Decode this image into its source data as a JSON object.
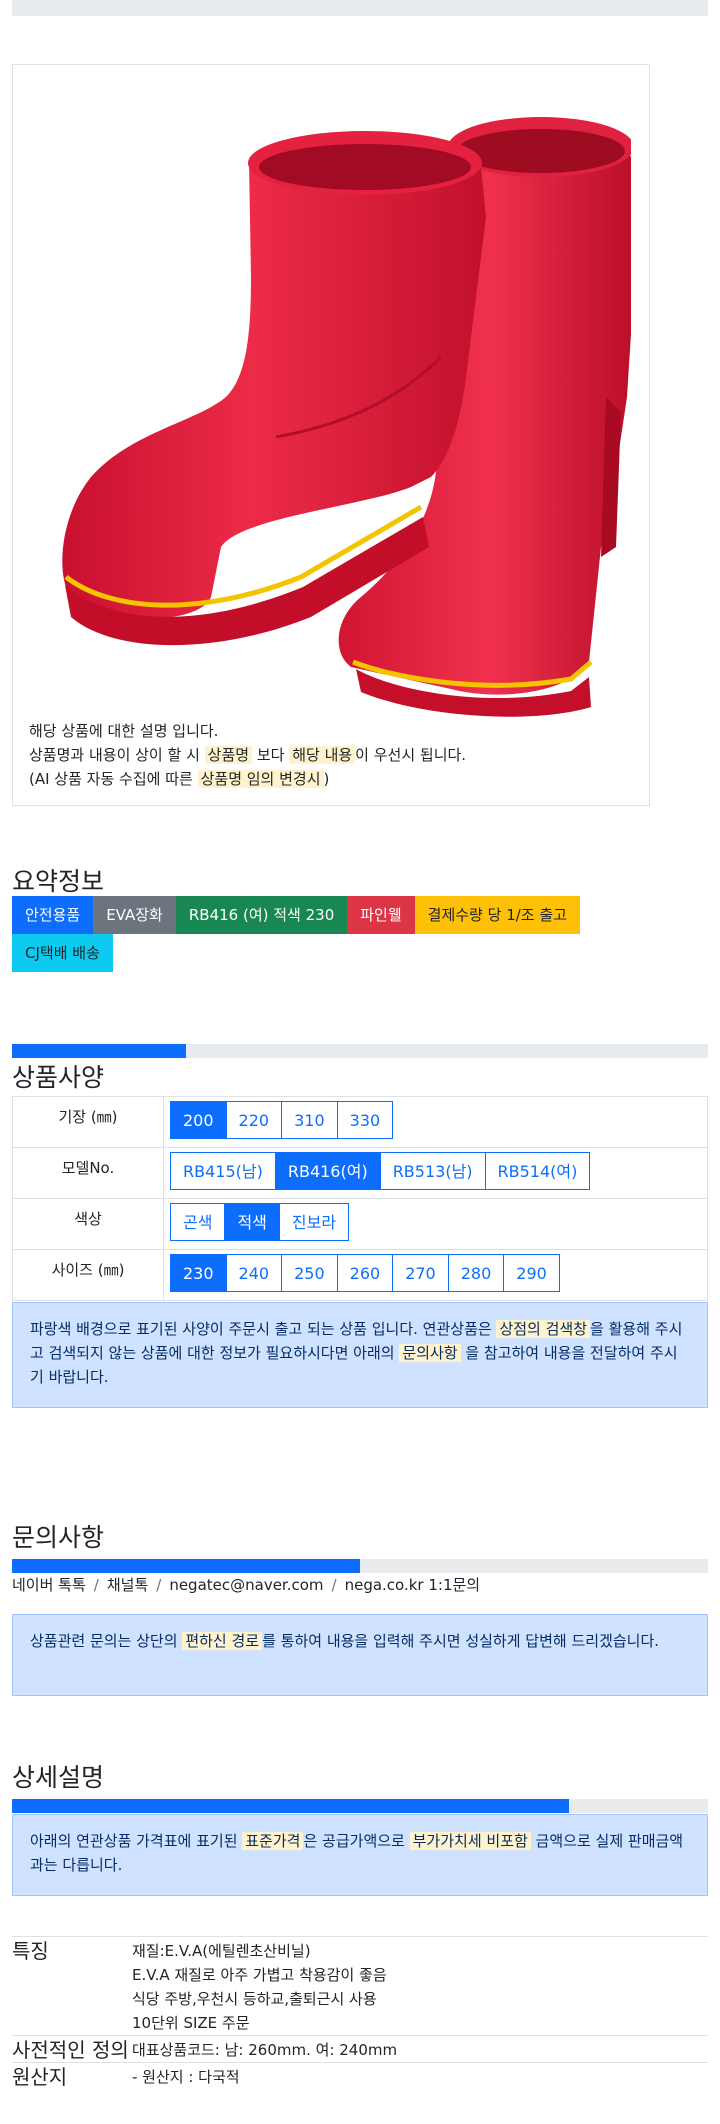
{
  "product": {
    "image_alt": "red rubber boots",
    "desc_line1": "해당 상품에 대한 설명 입니다.",
    "desc_line2_pre": "상품명과 내용이 상이 할 시 ",
    "desc_line2_hl1": "상품명",
    "desc_line2_mid": " 보다 ",
    "desc_line2_hl2": "해당 내용",
    "desc_line2_post": "이 우선시 됩니다.",
    "desc_line3_pre": "(AI 상품 자동 수집에 따른 ",
    "desc_line3_hl": "상품명 임의 변경시",
    "desc_line3_post": ")"
  },
  "summary": {
    "title": "요약정보",
    "badges": [
      "안전용품",
      "EVA장화",
      "RB416 (여) 적색 230",
      "파인웰",
      "결제수량 당 1/조 출고",
      "CJ택배 배송"
    ]
  },
  "spec": {
    "title": "상품사양",
    "progress": 0.25,
    "rows": [
      {
        "label": "기장 (㎜)",
        "options": [
          "200",
          "220",
          "310",
          "330"
        ],
        "selected": "200"
      },
      {
        "label": "모델No.",
        "options": [
          "RB415(남)",
          "RB416(여)",
          "RB513(남)",
          "RB514(여)"
        ],
        "selected": "RB416(여)"
      },
      {
        "label": "색상",
        "options": [
          "곤색",
          "적색",
          "진보라"
        ],
        "selected": "적색"
      },
      {
        "label": "사이즈 (㎜)",
        "options": [
          "230",
          "240",
          "250",
          "260",
          "270",
          "280",
          "290"
        ],
        "selected": "230"
      }
    ],
    "notice_pre": "파랑색 배경으로 표기된 사양이 주문시 출고 되는 상품 입니다. 연관상품은 ",
    "notice_hl1": "상점의 검색창",
    "notice_mid": "을 활용해 주시고 검색되지 않는 상품에 대한 정보가 필요하시다면 아래의 ",
    "notice_hl2": "문의사항",
    "notice_post": " 을 참고하여 내용을 전달하여 주시기 바랍니다."
  },
  "inquiry": {
    "title": "문의사항",
    "progress": 0.5,
    "links": [
      "네이버 톡톡",
      "채널톡",
      "negatec@naver.com",
      "nega.co.kr 1:1문의"
    ],
    "notice_pre": "상품관련 문의는 상단의 ",
    "notice_hl": "편하신 경로",
    "notice_post": "를 통하여 내용을 입력해 주시면 성실하게 답변해 드리겠습니다."
  },
  "detail": {
    "title": "상세설명",
    "progress": 0.8,
    "notice_pre": "아래의 연관상품 가격표에 표기된 ",
    "notice_hl1": "표준가격",
    "notice_mid": "은 공급가액으로 ",
    "notice_hl2": "부가가치세 비포함",
    "notice_post": " 금액으로 실제 판매금액과는 다릅니다.",
    "rows": [
      {
        "key": "특징",
        "lines": [
          "재질:E.V.A(에틸렌초산비닐)",
          "E.V.A 재질로 아주 가볍고 착용감이 좋음",
          "식당 주방,우천시 등하교,출퇴근시 사용",
          "10단위 SIZE 주문"
        ]
      },
      {
        "key": "사전적인 정의",
        "lines": [
          "대표상품코드: 남: 260mm. 여: 240mm"
        ]
      },
      {
        "key": "원산지",
        "lines": [
          "- 원산지 : 다국적"
        ]
      }
    ]
  },
  "colors": {
    "primary": "#0d6efd",
    "boot_red": "#e11e3f",
    "sole_yellow": "#f5c400",
    "highlight": "#fff3cd",
    "alert_bg": "#cfe2ff"
  }
}
